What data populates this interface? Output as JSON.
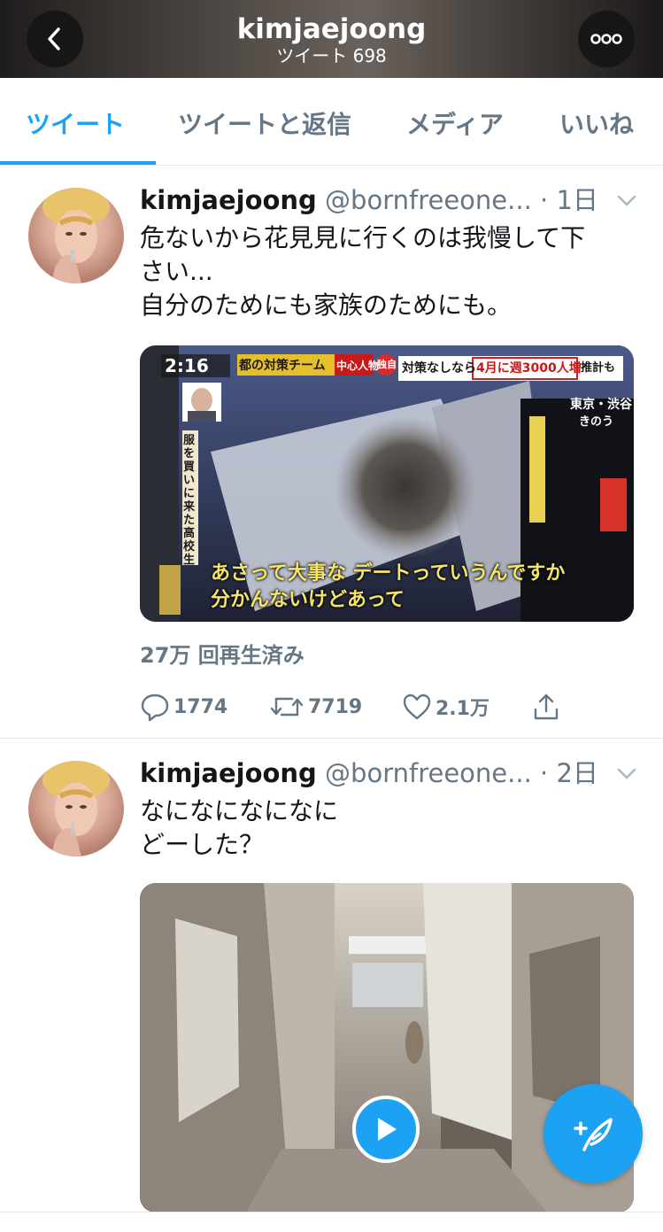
{
  "header": {
    "title": "kimjaejoong",
    "subtitle": "ツイート 698"
  },
  "tabs": [
    {
      "label": "ツイート",
      "active": true
    },
    {
      "label": "ツイートと返信",
      "active": false
    },
    {
      "label": "メディア",
      "active": false
    },
    {
      "label": "いいね",
      "active": false
    }
  ],
  "tweets": [
    {
      "name": "kimjaejoong",
      "handle": "@bornfreeone...",
      "date": "· 1日",
      "text": [
        "危ないから花見見に行くのは我慢して下",
        "さい...",
        "自分のためにも家族のためにも。"
      ],
      "media": {
        "clock": "2:16",
        "banner_left": "都の対策チーム",
        "banner_tag": "中心人物",
        "banner_exclusive": "独自",
        "banner_right_a": "対策なしなら",
        "banner_right_b": "4月に週3000人増",
        "banner_right_c": "推計も",
        "location": "東京・渋谷",
        "when": "きのう",
        "vertical_caption": "服を買いに来た高校生",
        "subtitle_1": "あさって大事な デートっていうんですか",
        "subtitle_2": "分かんないけどあって"
      },
      "views": "27万 回再生済み",
      "replies": "1774",
      "retweets": "7719",
      "likes": "2.1万"
    },
    {
      "name": "kimjaejoong",
      "handle": "@bornfreeone...",
      "date": "· 2日",
      "text": [
        "なになになになに",
        "どーした？"
      ]
    }
  ],
  "colors": {
    "accent": "#1da1f2",
    "text_secondary": "#657786",
    "divider": "#e1e8ed"
  }
}
